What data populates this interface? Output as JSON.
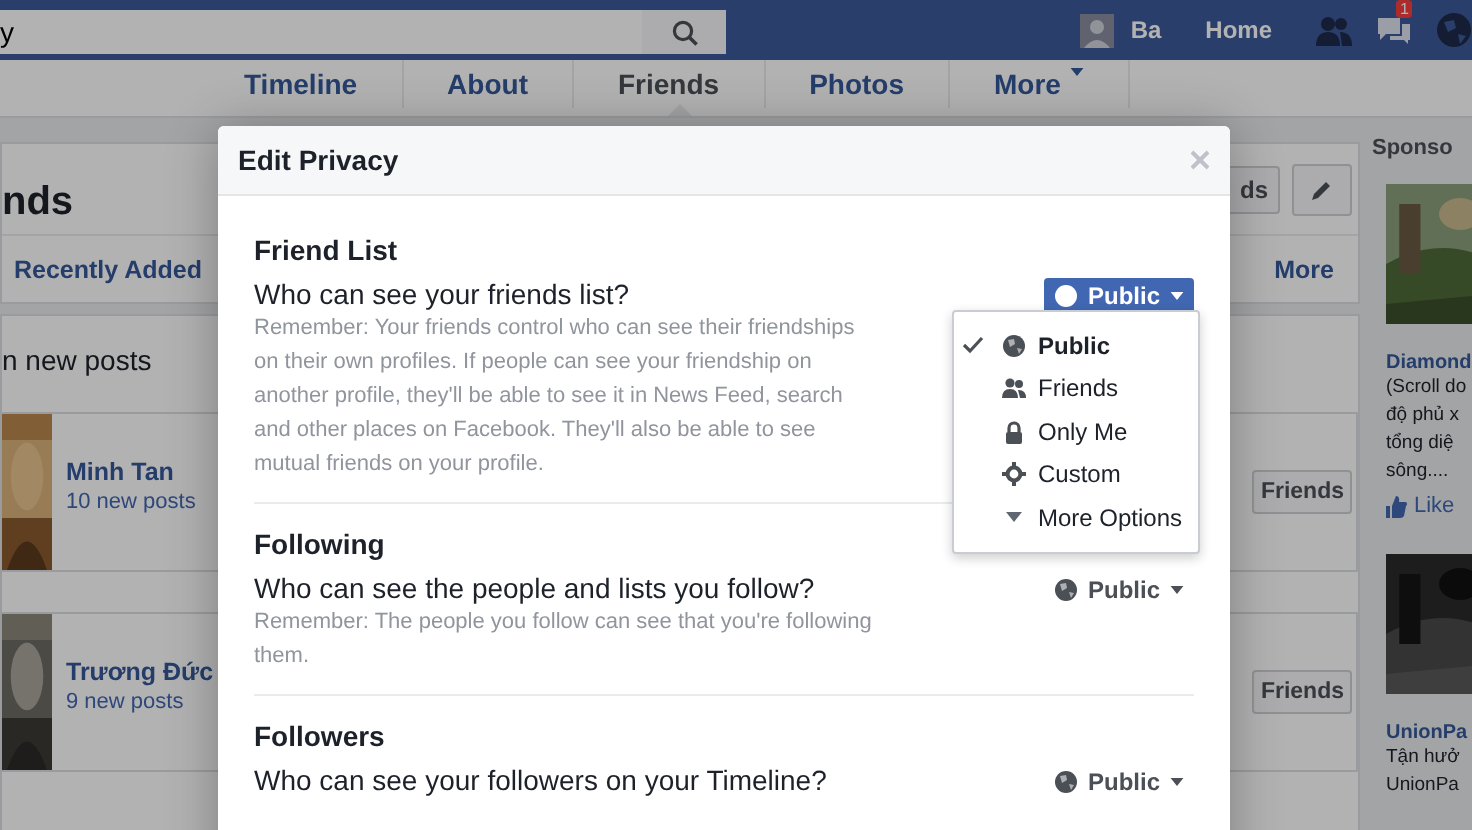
{
  "topbar": {
    "search": {
      "value": "y"
    },
    "profile_name": "Ba",
    "home": "Home",
    "notification_count": "1"
  },
  "tabs": [
    {
      "label": "Timeline",
      "selected": false
    },
    {
      "label": "About",
      "selected": false
    },
    {
      "label": "Friends",
      "selected": true
    },
    {
      "label": "Photos",
      "selected": false
    },
    {
      "label": "More",
      "selected": false
    }
  ],
  "friends_panel": {
    "title": "nds",
    "header_button": "ds",
    "filter": "Recently Added",
    "more": "More",
    "subheading": "n new posts",
    "friends": [
      {
        "name": "Minh Tan",
        "posts": "10 new posts",
        "button": "Friends"
      },
      {
        "name": "Trương Đức",
        "posts": "9 new posts",
        "button": "Friends"
      }
    ]
  },
  "sponsored": {
    "title": "Sponso",
    "ads": [
      {
        "title": "Diamond",
        "lines": [
          "(Scroll do",
          "độ phủ x",
          "tổng diệ",
          "sông...."
        ],
        "like": "Like"
      },
      {
        "title": "UnionPa",
        "lines": [
          "Tận hưở",
          "UnionPa"
        ]
      }
    ]
  },
  "modal": {
    "title": "Edit Privacy",
    "sections": [
      {
        "title": "Friend List",
        "question": "Who can see your friends list?",
        "note": "Remember: Your friends control who can see their friendships on their own profiles. If people can see your friendship on another profile, they'll be able to see it in News Feed, search and other places on Facebook. They'll also be able to see mutual friends on your profile.",
        "audience": "Public",
        "open": true
      },
      {
        "title": "Following",
        "question": "Who can see the people and lists you follow?",
        "note": "Remember: The people you follow can see that you're following them.",
        "audience": "Public",
        "open": false
      },
      {
        "title": "Followers",
        "question": "Who can see your followers on your Timeline?",
        "audience": "Public",
        "open": false
      }
    ],
    "menu": [
      {
        "label": "Public",
        "kind": "public",
        "selected": true
      },
      {
        "label": "Friends",
        "kind": "friends",
        "selected": false
      },
      {
        "label": "Only Me",
        "kind": "only_me",
        "selected": false
      },
      {
        "label": "Custom",
        "kind": "custom",
        "selected": false
      },
      {
        "label": "More Options",
        "kind": "more",
        "selected": false
      }
    ]
  }
}
